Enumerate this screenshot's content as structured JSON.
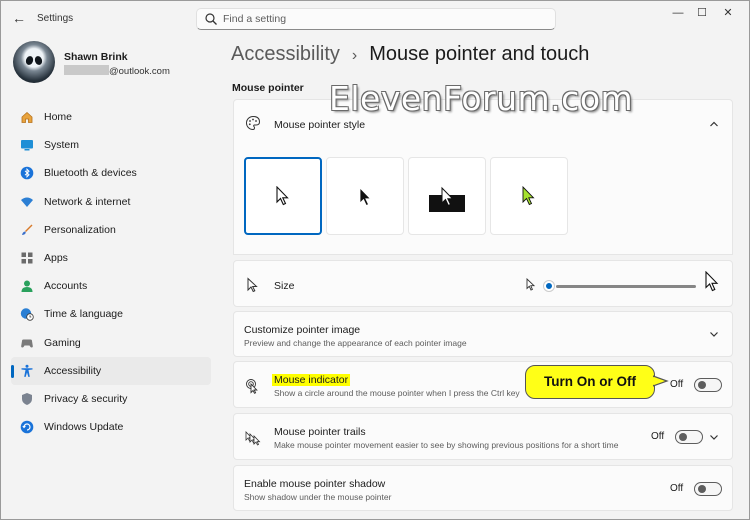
{
  "window": {
    "app_title": "Settings",
    "back_glyph": "←",
    "controls": {
      "minimize": "—",
      "maximize": "☐",
      "close": "✕"
    }
  },
  "search": {
    "placeholder": "Find a setting"
  },
  "profile": {
    "name": "Shawn Brink",
    "email_suffix": "@outlook.com"
  },
  "sidebar": {
    "items": [
      {
        "label": "Home",
        "icon": "home-icon",
        "active": false
      },
      {
        "label": "System",
        "icon": "system-icon",
        "active": false
      },
      {
        "label": "Bluetooth & devices",
        "icon": "bluetooth-icon",
        "active": false
      },
      {
        "label": "Network & internet",
        "icon": "network-icon",
        "active": false
      },
      {
        "label": "Personalization",
        "icon": "brush-icon",
        "active": false
      },
      {
        "label": "Apps",
        "icon": "apps-icon",
        "active": false
      },
      {
        "label": "Accounts",
        "icon": "accounts-icon",
        "active": false
      },
      {
        "label": "Time & language",
        "icon": "globe-clock-icon",
        "active": false
      },
      {
        "label": "Gaming",
        "icon": "gaming-icon",
        "active": false
      },
      {
        "label": "Accessibility",
        "icon": "accessibility-icon",
        "active": true
      },
      {
        "label": "Privacy & security",
        "icon": "shield-icon",
        "active": false
      },
      {
        "label": "Windows Update",
        "icon": "update-icon",
        "active": false
      }
    ]
  },
  "breadcrumb": {
    "parent": "Accessibility",
    "separator": "›",
    "current": "Mouse pointer and touch"
  },
  "section": {
    "title": "Mouse pointer"
  },
  "pointer_style": {
    "title": "Mouse pointer style",
    "options": [
      "white",
      "black",
      "inverted",
      "custom"
    ],
    "selected": "white",
    "custom_color": "#a6e22e"
  },
  "size": {
    "title": "Size",
    "level": 0
  },
  "customize_image": {
    "title": "Customize pointer image",
    "subtitle": "Preview and change the appearance of each pointer image"
  },
  "mouse_indicator": {
    "title": "Mouse indicator",
    "subtitle": "Show a circle around the mouse pointer when I press the Ctrl key",
    "state_label": "Off"
  },
  "trails": {
    "title": "Mouse pointer trails",
    "subtitle": "Make mouse pointer movement easier to see by showing previous positions for a short time",
    "state_label": "Off"
  },
  "shadow": {
    "title": "Enable mouse pointer shadow",
    "subtitle": "Show shadow under the mouse pointer",
    "state_label": "Off"
  },
  "annotation": {
    "callout": "Turn On or Off"
  },
  "watermark": {
    "text": "ElevenForum.com"
  },
  "colors": {
    "accent": "#0067c0",
    "highlight": "#ffff00",
    "callout_bg": "#ffff17"
  }
}
